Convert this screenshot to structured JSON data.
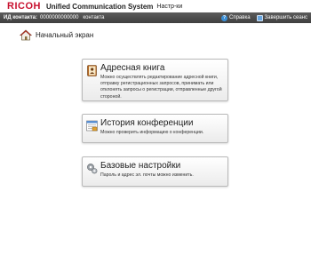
{
  "header": {
    "brand": "RICOH",
    "app_title": "Unified Communication System",
    "app_sub": "Настр-ки"
  },
  "status": {
    "contact_id_label": "ИД контакта:",
    "contact_id": "0000000000000",
    "contact_name": "контакта",
    "help": "Справка",
    "logout": "Завершить сеанс"
  },
  "home": {
    "label": "Начальный экран"
  },
  "cards": [
    {
      "title": "Адресная книга",
      "desc": "Можно осуществлять редактирование адресной книги, отправку регистрационных запросов, принимать или отклонять запросы о регистрации, отправленные другой стороной."
    },
    {
      "title": "История конференции",
      "desc": "Можно проверить информацию о конференции."
    },
    {
      "title": "Базовые настройки",
      "desc": "Пароль и адрес эл. почты можно изменить."
    }
  ],
  "colors": {
    "brand": "#c8102e",
    "statusbar": "#4a4a4a",
    "link_icon": "#3b8fd6"
  },
  "icons": [
    "home-icon",
    "address-book-icon",
    "conference-history-icon",
    "settings-icon",
    "help-icon",
    "logout-icon"
  ]
}
